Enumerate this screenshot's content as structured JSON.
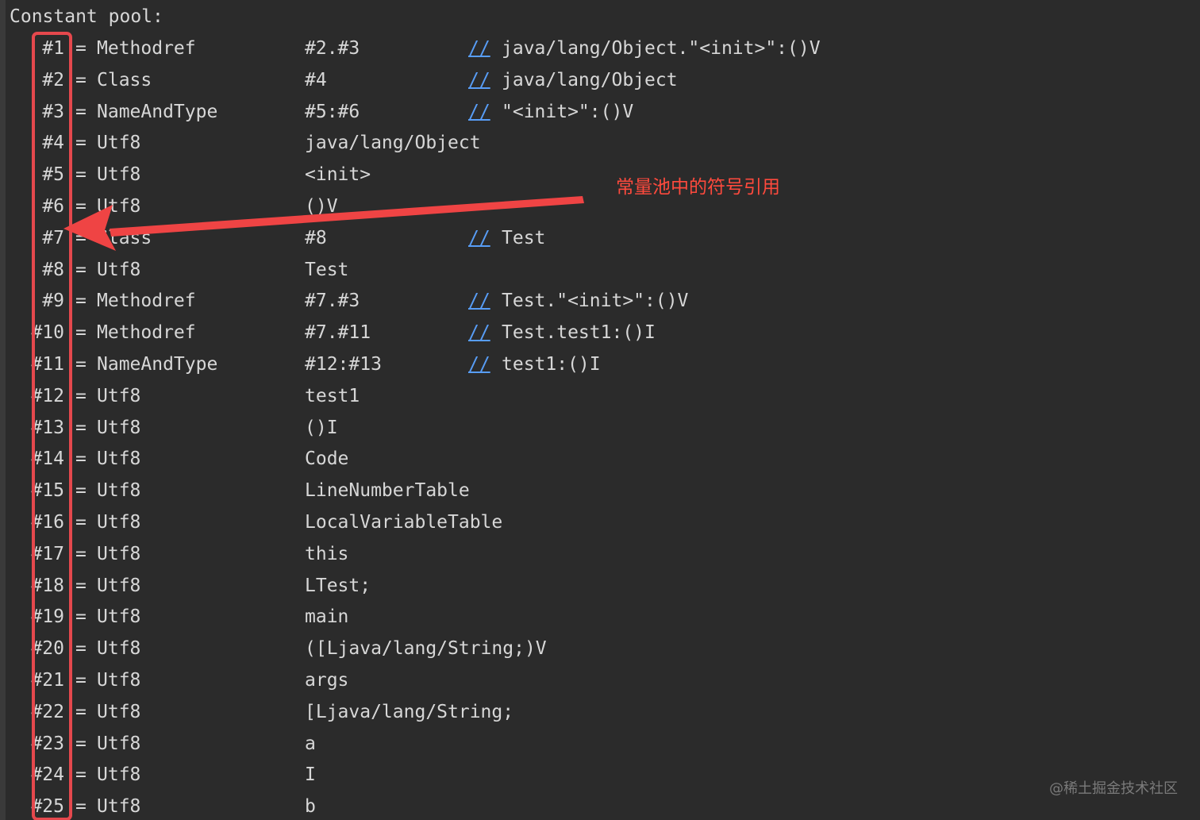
{
  "header": "Constant pool:",
  "entries": [
    {
      "idx": "#1",
      "eq": "=",
      "type": "Methodref",
      "ref": "#2.#3",
      "slash": "//",
      "comment": "java/lang/Object.\"<init>\":()V"
    },
    {
      "idx": "#2",
      "eq": "=",
      "type": "Class",
      "ref": "#4",
      "slash": "//",
      "comment": "java/lang/Object"
    },
    {
      "idx": "#3",
      "eq": "=",
      "type": "NameAndType",
      "ref": "#5:#6",
      "slash": "//",
      "comment": "\"<init>\":()V"
    },
    {
      "idx": "#4",
      "eq": "=",
      "type": "Utf8",
      "ref": "java/lang/Object",
      "slash": "",
      "comment": ""
    },
    {
      "idx": "#5",
      "eq": "=",
      "type": "Utf8",
      "ref": "<init>",
      "slash": "",
      "comment": ""
    },
    {
      "idx": "#6",
      "eq": "=",
      "type": "Utf8",
      "ref": "()V",
      "slash": "",
      "comment": ""
    },
    {
      "idx": "#7",
      "eq": "=",
      "type": "Class",
      "ref": "#8",
      "slash": "//",
      "comment": "Test"
    },
    {
      "idx": "#8",
      "eq": "=",
      "type": "Utf8",
      "ref": "Test",
      "slash": "",
      "comment": ""
    },
    {
      "idx": "#9",
      "eq": "=",
      "type": "Methodref",
      "ref": "#7.#3",
      "slash": "//",
      "comment": "Test.\"<init>\":()V"
    },
    {
      "idx": "#10",
      "eq": "=",
      "type": "Methodref",
      "ref": "#7.#11",
      "slash": "//",
      "comment": "Test.test1:()I"
    },
    {
      "idx": "#11",
      "eq": "=",
      "type": "NameAndType",
      "ref": "#12:#13",
      "slash": "//",
      "comment": "test1:()I"
    },
    {
      "idx": "#12",
      "eq": "=",
      "type": "Utf8",
      "ref": "test1",
      "slash": "",
      "comment": ""
    },
    {
      "idx": "#13",
      "eq": "=",
      "type": "Utf8",
      "ref": "()I",
      "slash": "",
      "comment": ""
    },
    {
      "idx": "#14",
      "eq": "=",
      "type": "Utf8",
      "ref": "Code",
      "slash": "",
      "comment": ""
    },
    {
      "idx": "#15",
      "eq": "=",
      "type": "Utf8",
      "ref": "LineNumberTable",
      "slash": "",
      "comment": ""
    },
    {
      "idx": "#16",
      "eq": "=",
      "type": "Utf8",
      "ref": "LocalVariableTable",
      "slash": "",
      "comment": ""
    },
    {
      "idx": "#17",
      "eq": "=",
      "type": "Utf8",
      "ref": "this",
      "slash": "",
      "comment": ""
    },
    {
      "idx": "#18",
      "eq": "=",
      "type": "Utf8",
      "ref": "LTest;",
      "slash": "",
      "comment": ""
    },
    {
      "idx": "#19",
      "eq": "=",
      "type": "Utf8",
      "ref": "main",
      "slash": "",
      "comment": ""
    },
    {
      "idx": "#20",
      "eq": "=",
      "type": "Utf8",
      "ref": "([Ljava/lang/String;)V",
      "slash": "",
      "comment": ""
    },
    {
      "idx": "#21",
      "eq": "=",
      "type": "Utf8",
      "ref": "args",
      "slash": "",
      "comment": ""
    },
    {
      "idx": "#22",
      "eq": "=",
      "type": "Utf8",
      "ref": "[Ljava/lang/String;",
      "slash": "",
      "comment": ""
    },
    {
      "idx": "#23",
      "eq": "=",
      "type": "Utf8",
      "ref": "a",
      "slash": "",
      "comment": ""
    },
    {
      "idx": "#24",
      "eq": "=",
      "type": "Utf8",
      "ref": "I",
      "slash": "",
      "comment": ""
    },
    {
      "idx": "#25",
      "eq": "=",
      "type": "Utf8",
      "ref": "b",
      "slash": "",
      "comment": ""
    }
  ],
  "annotation": "常量池中的符号引用",
  "watermark": "@稀土掘金技术社区",
  "colors": {
    "background": "#2b2b2b",
    "text": "#d7d7d7",
    "comment_slash": "#589df6",
    "highlight": "#e5484d",
    "annotation": "#ff4a3d"
  }
}
